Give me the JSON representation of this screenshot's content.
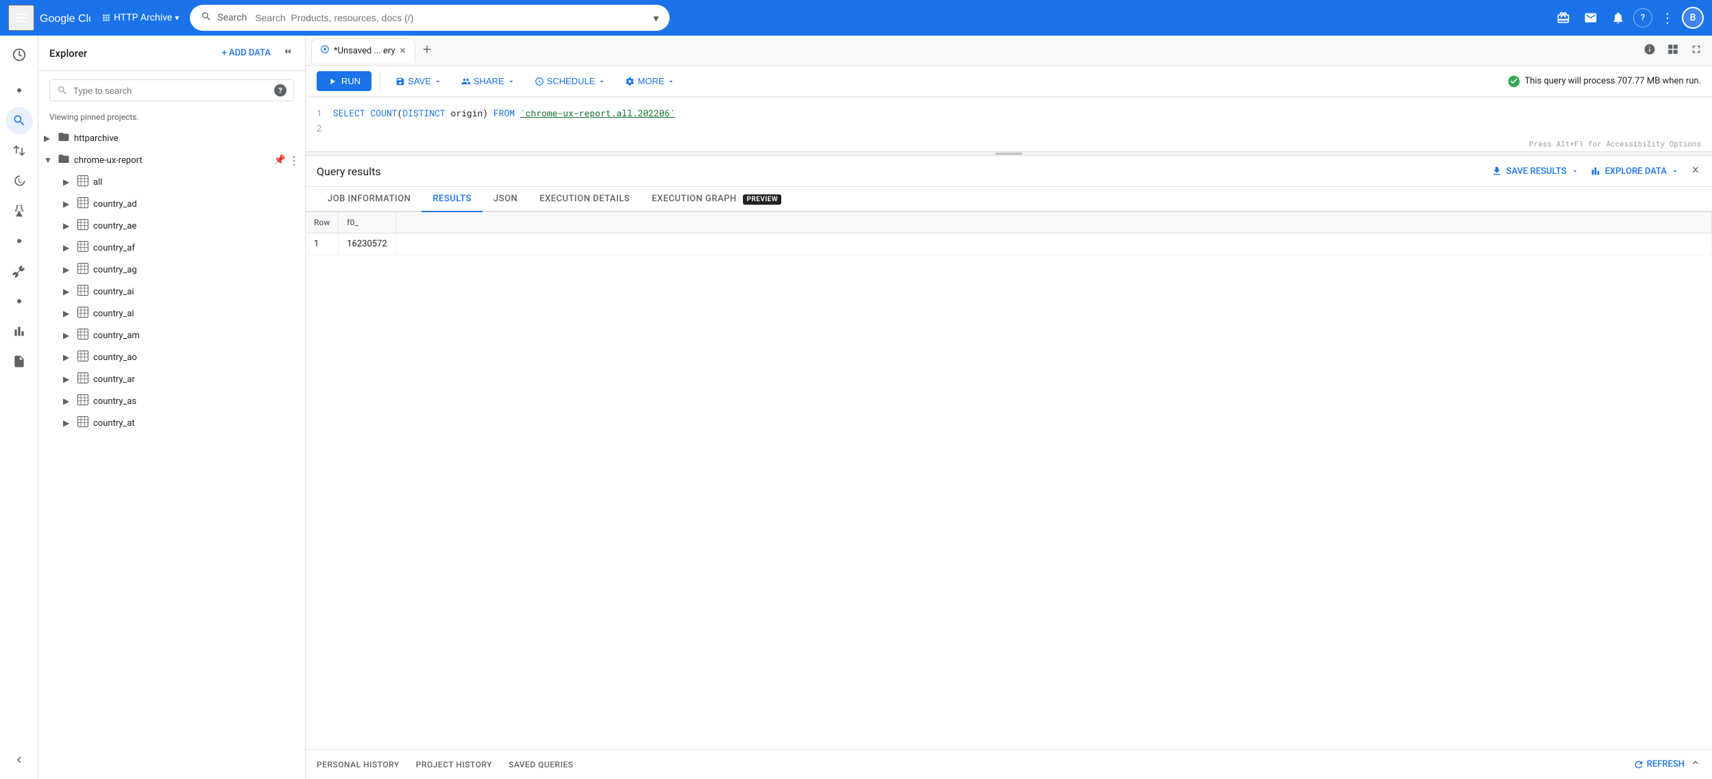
{
  "topnav": {
    "hamburger_icon": "☰",
    "logo_text": "Google Cloud",
    "product_name": "HTTP Archive",
    "product_dropdown_icon": "▾",
    "search_placeholder": "Search  Products, resources, docs (/)",
    "search_dropdown_icon": "▾",
    "gift_icon": "🎁",
    "email_icon": "✉",
    "bell_icon": "🔔",
    "help_icon": "?",
    "more_icon": "⋮",
    "avatar_letter": "B",
    "avatar_bg": "#4285f4"
  },
  "sidebar": {
    "icons": [
      {
        "name": "dot-icon-1",
        "symbol": "•",
        "active": false
      },
      {
        "name": "search-icon",
        "symbol": "🔍",
        "active": true
      },
      {
        "name": "transfer-icon",
        "symbol": "⇄",
        "active": false
      },
      {
        "name": "history-icon",
        "symbol": "🕐",
        "active": false
      },
      {
        "name": "lab-icon",
        "symbol": "⚗",
        "active": false
      },
      {
        "name": "dot-icon-2",
        "symbol": "•",
        "active": false
      },
      {
        "name": "wrench-icon",
        "symbol": "🔧",
        "active": false
      },
      {
        "name": "dot-icon-3",
        "symbol": "•",
        "active": false
      },
      {
        "name": "chart-icon",
        "symbol": "📊",
        "active": false
      },
      {
        "name": "doc-icon",
        "symbol": "📄",
        "active": false
      }
    ]
  },
  "explorer": {
    "title": "Explorer",
    "add_data_label": "+ ADD DATA",
    "collapse_icon": "◀",
    "search_placeholder": "Type to search",
    "help_label": "?",
    "viewing_text": "Viewing pinned projects.",
    "tree": [
      {
        "id": "httparchive",
        "label": "httparchive",
        "expanded": false,
        "level": 0,
        "has_arrow": true,
        "has_pin": false,
        "has_more": true
      },
      {
        "id": "chrome-ux-report",
        "label": "chrome-ux-report",
        "expanded": true,
        "level": 0,
        "has_arrow": true,
        "has_pin": true,
        "has_more": true
      },
      {
        "id": "all",
        "label": "all",
        "expanded": false,
        "level": 1,
        "has_arrow": true,
        "has_more": true
      },
      {
        "id": "country_ad",
        "label": "country_ad",
        "expanded": false,
        "level": 1,
        "has_arrow": true,
        "has_more": true
      },
      {
        "id": "country_ae",
        "label": "country_ae",
        "expanded": false,
        "level": 1,
        "has_arrow": true,
        "has_more": true
      },
      {
        "id": "country_af",
        "label": "country_af",
        "expanded": false,
        "level": 1,
        "has_arrow": true,
        "has_more": true
      },
      {
        "id": "country_ag",
        "label": "country_ag",
        "expanded": false,
        "level": 1,
        "has_arrow": true,
        "has_more": true
      },
      {
        "id": "country_ai",
        "label": "country_ai",
        "expanded": false,
        "level": 1,
        "has_arrow": true,
        "has_more": true
      },
      {
        "id": "country_al",
        "label": "country_al",
        "expanded": false,
        "level": 1,
        "has_arrow": true,
        "has_more": true
      },
      {
        "id": "country_am",
        "label": "country_am",
        "expanded": false,
        "level": 1,
        "has_arrow": true,
        "has_more": true
      },
      {
        "id": "country_ao",
        "label": "country_ao",
        "expanded": false,
        "level": 1,
        "has_arrow": true,
        "has_more": true
      },
      {
        "id": "country_ar",
        "label": "country_ar",
        "expanded": false,
        "level": 1,
        "has_arrow": true,
        "has_more": true
      },
      {
        "id": "country_as",
        "label": "country_as",
        "expanded": false,
        "level": 1,
        "has_arrow": true,
        "has_more": true
      },
      {
        "id": "country_at",
        "label": "country_at",
        "expanded": false,
        "level": 1,
        "has_arrow": true,
        "has_more": true
      }
    ]
  },
  "query_editor": {
    "tab_label": "*Unsaved ... ery",
    "tab_icon": "⊙",
    "close_icon": "✕",
    "add_tab_icon": "+",
    "info_icon": "ℹ",
    "grid_icon": "⊞",
    "fullscreen_icon": "⛶",
    "run_label": "RUN",
    "run_icon": "▶",
    "save_label": "SAVE",
    "save_icon": "💾",
    "share_label": "SHARE",
    "share_icon": "👥",
    "schedule_label": "SCHEDULE",
    "schedule_icon": "🕐",
    "more_label": "MORE",
    "more_icon": "⚙",
    "query_info": "This query will process 707.77 MB when run.",
    "check_icon": "✔",
    "line1": "SELECT COUNT(DISTINCT origin) FROM `chrome-ux-report.all.202206`",
    "line1_parts": {
      "select": "SELECT",
      "count_fn": "COUNT(DISTINCT",
      "col": "origin)",
      "from": "FROM",
      "table": "`chrome-ux-report.all.202206`"
    },
    "line2": "",
    "accessibility_hint": "Press Alt+F1 for Accessibility Options"
  },
  "results": {
    "title": "Query results",
    "save_results_label": "SAVE RESULTS",
    "save_results_icon": "⬇",
    "explore_data_label": "EXPLORE DATA",
    "explore_icon": "📊",
    "expand_icon": "⇅",
    "tabs": [
      {
        "id": "job-information",
        "label": "JOB INFORMATION",
        "active": false
      },
      {
        "id": "results",
        "label": "RESULTS",
        "active": true
      },
      {
        "id": "json",
        "label": "JSON",
        "active": false
      },
      {
        "id": "execution-details",
        "label": "EXECUTION DETAILS",
        "active": false
      },
      {
        "id": "execution-graph",
        "label": "EXECUTION GRAPH",
        "active": false,
        "badge": "PREVIEW"
      }
    ],
    "table": {
      "headers": [
        "Row",
        "f0_"
      ],
      "rows": [
        {
          "row": "1",
          "value": "16230572"
        }
      ]
    }
  },
  "history_bar": {
    "tabs": [
      {
        "label": "PERSONAL HISTORY"
      },
      {
        "label": "PROJECT HISTORY"
      },
      {
        "label": "SAVED QUERIES"
      }
    ],
    "refresh_label": "REFRESH",
    "refresh_icon": "↻",
    "collapse_icon": "∧"
  }
}
